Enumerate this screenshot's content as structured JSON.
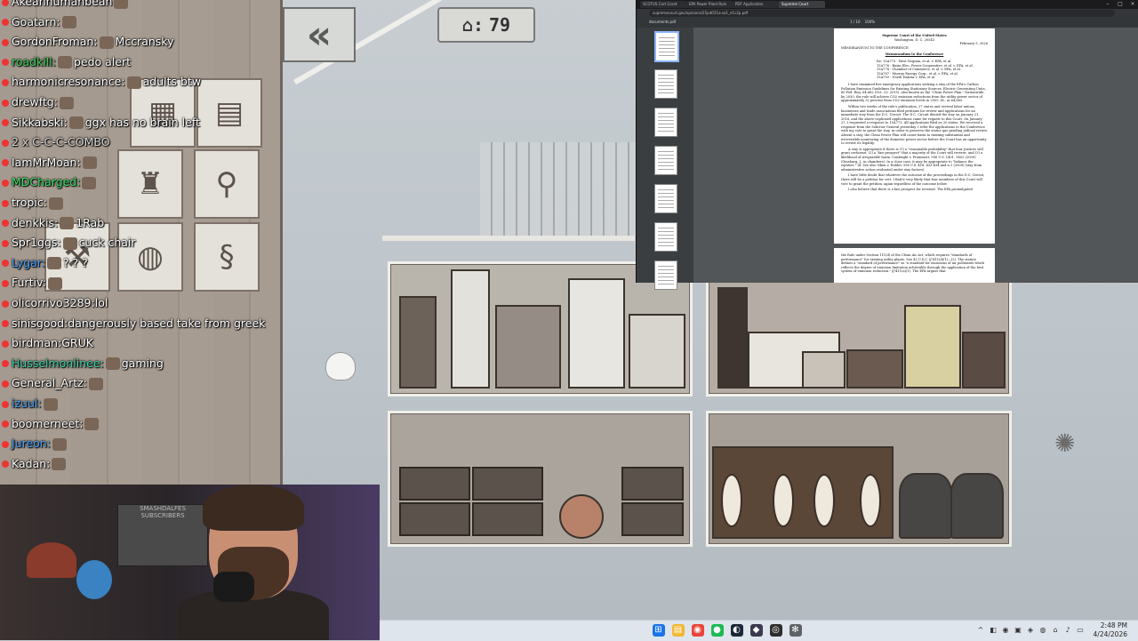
{
  "hud": {
    "back_icon": "double-chevron-left-icon",
    "back_glyph": "«",
    "counter_icon": "house-icon",
    "counter_glyph": "⌂:",
    "counter_value": "79"
  },
  "chat": {
    "messages": [
      {
        "user": "Akeanhumanbean",
        "user_color": "#ffffff",
        "text": "",
        "emote": true
      },
      {
        "user": "Goatarn:",
        "user_color": "#ffffff",
        "text": "",
        "emote": true
      },
      {
        "user": "GordonFroman:",
        "user_color": "#ffffff",
        "text": "Mccransky",
        "emote": true
      },
      {
        "user": "roadkill:",
        "user_color": "#3fd35b",
        "text": "pedo alert",
        "emote": true
      },
      {
        "user": "harmonicresonance:",
        "user_color": "#ffffff",
        "text": "adults btw",
        "emote": true
      },
      {
        "user": "drewftg:",
        "user_color": "#ffffff",
        "text": "",
        "emote": true
      },
      {
        "user": "Sikkabski:",
        "user_color": "#ffffff",
        "text": "ggx has no brain left",
        "emote": true
      },
      {
        "user": "2 x C-C-C-COMBO",
        "user_color": "#d8d8d8",
        "text": "",
        "emote": false
      },
      {
        "user": "IamMrMoan:",
        "user_color": "#ffffff",
        "text": "",
        "emote": true
      },
      {
        "user": "MDCharged:",
        "user_color": "#3fe06a",
        "text": "",
        "emote": true
      },
      {
        "user": "tropic:",
        "user_color": "#ffffff",
        "text": "",
        "emote": true
      },
      {
        "user": "denkkis:",
        "user_color": "#ffffff",
        "text": "1Rab",
        "emote": true
      },
      {
        "user": "Spr1ggs:",
        "user_color": "#ffffff",
        "text": "cuck chair",
        "emote": true
      },
      {
        "user": "Lygar:",
        "user_color": "#4aa4ff",
        "text": "? ? ?",
        "emote": true
      },
      {
        "user": "Furtiv:",
        "user_color": "#ffffff",
        "text": "",
        "emote": true
      },
      {
        "user": "olicorrivo3289:",
        "user_color": "#ffffff",
        "text": "lol",
        "emote": false
      },
      {
        "user": "sinisgood:",
        "user_color": "#ffffff",
        "text": "dangerously based take from greek",
        "emote": false
      },
      {
        "user": "birdman:",
        "user_color": "#ffffff",
        "text": "GRUK",
        "emote": false
      },
      {
        "user": "Husselmonlinee:",
        "user_color": "#3fd3a8",
        "text": "gaming",
        "emote": true
      },
      {
        "user": "General_Artz:",
        "user_color": "#ffffff",
        "text": "",
        "emote": true
      },
      {
        "user": "izuul:",
        "user_color": "#4aa4ff",
        "text": "",
        "emote": true
      },
      {
        "user": "boomerneet:",
        "user_color": "#ffffff",
        "text": "",
        "emote": true
      },
      {
        "user": "Jureon:",
        "user_color": "#4aa4ff",
        "text": "",
        "emote": true
      },
      {
        "user": "Kadan:",
        "user_color": "#ffffff",
        "text": "",
        "emote": true
      }
    ]
  },
  "webcam": {
    "calendar_title": "SMASHDALFES SUBSCRIBERS"
  },
  "browser": {
    "tabs": [
      "SCOTUS Cert Grant",
      "EPA Power Plant Rule",
      "PDF Application",
      "Supreme Court"
    ],
    "active_tab": 3,
    "url": "supremecourt.gov/opinions/25pdf/21a-sa1_e1c2p.pdf",
    "pdf_filename": "documents.pdf",
    "pdf_page_indicator": "1 / 10",
    "pdf_zoom": "100%",
    "doc": {
      "court": "Supreme Court of the United States",
      "place": "Washington, D. C. 20543",
      "date": "February 5, 2026",
      "to": "MEMORANDUM TO THE CONFERENCE",
      "heading": "Memorandum to the Conference",
      "re_lines": [
        "Re: 15A773 - West Virginia, et al. v. EPA, et al.",
        "15A776 - Basin Elec. Power Cooperative, et al. v. EPA, et al.",
        "15A778 - Chamber of Commerce, et al. v. EPA, et al.",
        "15A787 - Murray Energy Corp., et al. v. EPA, et al.",
        "15A793 - North Dakota v. EPA, et al."
      ],
      "para1": "I have examined five emergency applications seeking a stay of the EPA's Carbon Pollution Emission Guidelines for Existing Stationary Sources: Electric Generating Units, 80 Fed. Reg. 64,662 (Oct. 23, 2015), also known as the \"Clean Power Plan.\" Nationwide, by 2030, the rule will achieve CO2 emission reductions from the utility power sector of approximately 32 percent from CO2 emission levels in 2005. Id., at 64,665.",
      "para2": "Within two weeks of the rule's publication, 27 states and several labor unions, businesses and trade associations filed petitions for review and applications for an immediate stay from the D.C. Circuit. The D.C. Circuit denied the stay on January 21, 2016, and the above-captioned applications came for request to this Court. On January 27, I requested a response to 15A773. All applications filed on 20 states. We received a response from the Solicitor General yesterday. I refer the applications to the Conference with my vote to grant the stay, in order to preserve the status quo pending judicial review. Absent a stay, the Clean Power Plan will cause harm to existing substantial and irreversible monitoring of the domestic power sector before the Court has an opportunity to review its legality.",
      "para3": "A stay is appropriate if there is (1) a \"reasonable probability\" that four Justices will grant certiorari, (2) a \"fair prospect\" that a majority of the Court will reverse, and (3) a likelihood of irreparable harm. Conkright v. Frommert, 556 U.S. 1401, 1402 (2009) (Ginsburg, J., in chambers). In a close case, it may be appropriate to \"balance the equities.\" Id. See also Nken v. Holder, 556 U.S. 418, 433-434 and n.1 (2009) (stay from administrative action evaluated under stay factors).",
      "para4": "I have little doubt that whatever the outcome of the proceedings in the D.C. Circuit, there will be a petition for cert. I find it very likely that four members of this Court will vote to grant the petition, again regardless of the outcome below.",
      "para5": "I also believe that there is a fair prospect for reversal. The EPA promulgated",
      "page2_para": "the Rule under Section 111(d) of the Clean Air Act, which requires \"standards of performance\" for existing utility plants. See 42 U.S.C. §7411(d)(1)—(2). The statute defines a \"standard of performance\" as \"a standard for emissions of air pollutants which reflects the degree of emission limitation achievable through the application of the best system of emission reduction.\" §7411(a)(1). The EPA argues that"
    }
  },
  "taskbar": {
    "apps": [
      {
        "name": "start-button",
        "glyph": "⊞",
        "color": "#1a73e8"
      },
      {
        "name": "file-explorer-icon",
        "glyph": "▤",
        "color": "#f2b632"
      },
      {
        "name": "chrome-icon",
        "glyph": "◉",
        "color": "#e8453c"
      },
      {
        "name": "spotify-icon",
        "glyph": "●",
        "color": "#1db954"
      },
      {
        "name": "steam-icon",
        "glyph": "◐",
        "color": "#1b2838"
      },
      {
        "name": "twitch-icon",
        "glyph": "◆",
        "color": "#3b3b4f"
      },
      {
        "name": "obs-icon",
        "glyph": "◎",
        "color": "#2d2d2d"
      },
      {
        "name": "settings-icon",
        "glyph": "✻",
        "color": "#5f6368"
      }
    ],
    "time": "2:48 PM",
    "date": "4/24/2026"
  },
  "colors": {
    "taskbar_bg": "#dfe5ec",
    "chat_text": "#ffffff",
    "browser_bg": "#202124",
    "pdf_bg": "#525659"
  }
}
